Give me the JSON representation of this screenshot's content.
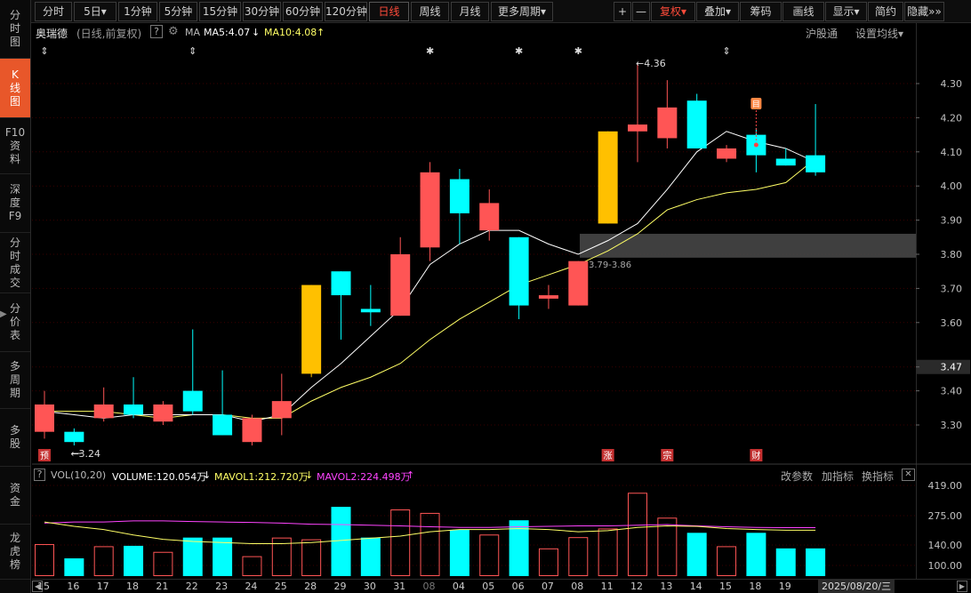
{
  "left_tabs": [
    {
      "label": "分\n时\n图",
      "name": "tab-fenshitu",
      "active": false
    },
    {
      "label": "K\n线\n图",
      "name": "tab-kxiantu",
      "active": true
    },
    {
      "label": "F10\n资\n料",
      "name": "tab-f10",
      "active": false
    },
    {
      "label": "深\n度\nF9",
      "name": "tab-f9",
      "active": false
    },
    {
      "label": "分\n时\n成\n交",
      "name": "tab-fenshichengjiao",
      "active": false
    },
    {
      "label": "分\n价\n表",
      "name": "tab-fenjiabiao",
      "active": false
    },
    {
      "label": "多\n周\n期",
      "name": "tab-duozhouqi",
      "active": false
    },
    {
      "label": "多\n股",
      "name": "tab-duogu",
      "active": false
    },
    {
      "label": "资\n金",
      "name": "tab-zijin",
      "active": false
    },
    {
      "label": "龙\n虎\n榜",
      "name": "tab-longhubang",
      "active": false
    }
  ],
  "toolbar": {
    "periods": [
      "分时",
      "5日▾",
      "1分钟",
      "5分钟",
      "15分钟",
      "30分钟",
      "60分钟",
      "120分钟",
      "日线",
      "周线",
      "月线",
      "更多周期▾"
    ],
    "active_period": "日线",
    "tools": [
      "+",
      "—",
      "复权▾",
      "叠加▾",
      "筹码",
      "画线",
      "显示▾",
      "简约",
      "隐藏»»"
    ]
  },
  "info": {
    "name": "奥瑞德",
    "mode": "(日线,前复权)",
    "help": "?",
    "ma_label": "MA",
    "ma5": "MA5:4.07",
    "ma10": "MA10:4.08",
    "connect": "沪股通",
    "settings": "设置均线▾"
  },
  "colors": {
    "up": "#ff5555",
    "down": "#00ffff",
    "limit_up": "#ffc000",
    "ma5": "#ffffff",
    "ma10": "#ffff66",
    "mavol2": "#ff44ff",
    "grid": "#3a0000"
  },
  "price_axis": {
    "min": 3.22,
    "max": 4.36,
    "ticks": [
      "4.30",
      "4.20",
      "4.10",
      "4.00",
      "3.90",
      "3.80",
      "3.70",
      "3.60",
      "3.47",
      "3.40",
      "3.30"
    ],
    "highlight_tick": "3.47"
  },
  "chart_data": {
    "type": "candlestick",
    "dates": [
      "15",
      "16",
      "17",
      "18",
      "21",
      "22",
      "23",
      "24",
      "25",
      "28",
      "29",
      "30",
      "31",
      "08",
      "04",
      "05",
      "06",
      "07",
      "08",
      "11",
      "12",
      "13",
      "14",
      "15",
      "18",
      "19",
      "20"
    ],
    "candles": [
      {
        "o": 3.28,
        "h": 3.4,
        "l": 3.26,
        "c": 3.36,
        "limit": false
      },
      {
        "o": 3.28,
        "h": 3.29,
        "l": 3.24,
        "c": 3.25,
        "limit": false
      },
      {
        "o": 3.32,
        "h": 3.41,
        "l": 3.31,
        "c": 3.36,
        "limit": false
      },
      {
        "o": 3.36,
        "h": 3.44,
        "l": 3.32,
        "c": 3.33,
        "limit": false
      },
      {
        "o": 3.31,
        "h": 3.37,
        "l": 3.3,
        "c": 3.36,
        "limit": false
      },
      {
        "o": 3.4,
        "h": 3.58,
        "l": 3.33,
        "c": 3.34,
        "limit": false
      },
      {
        "o": 3.33,
        "h": 3.46,
        "l": 3.27,
        "c": 3.27,
        "limit": false
      },
      {
        "o": 3.25,
        "h": 3.33,
        "l": 3.24,
        "c": 3.32,
        "limit": false
      },
      {
        "o": 3.32,
        "h": 3.45,
        "l": 3.27,
        "c": 3.37,
        "limit": false
      },
      {
        "o": 3.45,
        "h": 3.71,
        "l": 3.44,
        "c": 3.71,
        "limit": true
      },
      {
        "o": 3.75,
        "h": 3.75,
        "l": 3.55,
        "c": 3.68,
        "limit": false
      },
      {
        "o": 3.64,
        "h": 3.71,
        "l": 3.59,
        "c": 3.63,
        "limit": false
      },
      {
        "o": 3.62,
        "h": 3.85,
        "l": 3.62,
        "c": 3.8,
        "limit": false
      },
      {
        "o": 3.82,
        "h": 4.07,
        "l": 3.78,
        "c": 4.04,
        "limit": false
      },
      {
        "o": 4.02,
        "h": 4.05,
        "l": 3.83,
        "c": 3.92,
        "limit": false
      },
      {
        "o": 3.87,
        "h": 3.99,
        "l": 3.84,
        "c": 3.95,
        "limit": false
      },
      {
        "o": 3.85,
        "h": 3.85,
        "l": 3.61,
        "c": 3.65,
        "limit": false
      },
      {
        "o": 3.67,
        "h": 3.71,
        "l": 3.64,
        "c": 3.68,
        "limit": false
      },
      {
        "o": 3.65,
        "h": 3.78,
        "l": 3.65,
        "c": 3.78,
        "limit": false
      },
      {
        "o": 3.89,
        "h": 4.16,
        "l": 3.89,
        "c": 4.16,
        "limit": true
      },
      {
        "o": 4.16,
        "h": 4.36,
        "l": 4.07,
        "c": 4.18,
        "limit": false
      },
      {
        "o": 4.14,
        "h": 4.31,
        "l": 4.11,
        "c": 4.23,
        "limit": false
      },
      {
        "o": 4.25,
        "h": 4.27,
        "l": 4.11,
        "c": 4.11,
        "limit": false
      },
      {
        "o": 4.08,
        "h": 4.12,
        "l": 4.07,
        "c": 4.11,
        "limit": false
      },
      {
        "o": 4.15,
        "h": 4.17,
        "l": 4.04,
        "c": 4.09,
        "limit": false
      },
      {
        "o": 4.08,
        "h": 4.11,
        "l": 4.06,
        "c": 4.06,
        "limit": false
      },
      {
        "o": 4.09,
        "h": 4.24,
        "l": 4.03,
        "c": 4.04,
        "limit": false
      }
    ],
    "ma5": [
      3.34,
      3.33,
      3.32,
      3.33,
      3.33,
      3.33,
      3.33,
      3.31,
      3.33,
      3.41,
      3.48,
      3.56,
      3.64,
      3.77,
      3.83,
      3.87,
      3.87,
      3.83,
      3.8,
      3.84,
      3.89,
      3.99,
      4.1,
      4.16,
      4.13,
      4.11,
      4.07
    ],
    "ma10": [
      3.34,
      3.34,
      3.34,
      3.33,
      3.32,
      3.33,
      3.33,
      3.32,
      3.32,
      3.37,
      3.41,
      3.44,
      3.48,
      3.55,
      3.61,
      3.66,
      3.71,
      3.74,
      3.77,
      3.81,
      3.86,
      3.93,
      3.96,
      3.98,
      3.99,
      4.01,
      4.08
    ],
    "annotations": {
      "low": "3.24",
      "high": "4.36",
      "gap": "3.79-3.86",
      "gap_range": [
        3.79,
        3.86
      ]
    },
    "tags": [
      {
        "index": 0,
        "label": "预"
      },
      {
        "index": 19,
        "label": "涨"
      },
      {
        "index": 21,
        "label": "宗"
      },
      {
        "index": 24,
        "label": "财"
      }
    ],
    "note_icon": {
      "index": 24,
      "label": "目"
    },
    "top_markers": [
      {
        "index": 0,
        "glyph": "⇕"
      },
      {
        "index": 5,
        "glyph": "⇕"
      },
      {
        "index": 13,
        "glyph": "✱"
      },
      {
        "index": 16,
        "glyph": "✱"
      },
      {
        "index": 18,
        "glyph": "✱"
      },
      {
        "index": 23,
        "glyph": "⇕"
      }
    ],
    "volume": {
      "max": 419,
      "ticks": [
        "419.00",
        "275.00",
        "140.00",
        "100.00"
      ],
      "values": [
        148,
        82,
        138,
        140,
        112,
        178,
        178,
        92,
        178,
        170,
        320,
        178,
        308,
        292,
        214,
        192,
        258,
        128,
        180,
        220,
        385,
        270,
        200,
        138,
        200,
        128,
        128,
        110
      ],
      "mavol1": [
        250,
        230,
        215,
        190,
        170,
        160,
        155,
        150,
        150,
        155,
        165,
        175,
        185,
        205,
        215,
        215,
        220,
        215,
        205,
        210,
        225,
        232,
        230,
        220,
        215,
        212,
        212
      ],
      "mavol2": [
        245,
        250,
        250,
        255,
        255,
        252,
        250,
        248,
        245,
        240,
        238,
        235,
        232,
        228,
        225,
        225,
        228,
        230,
        232,
        232,
        235,
        238,
        232,
        228,
        225,
        224,
        224
      ]
    }
  },
  "vol_info": {
    "help": "?",
    "label": "VOL(10,20)",
    "volume": "VOLUME:120.054万",
    "mavol1": "MAVOL1:212.720万",
    "mavol2": "MAVOL2:224.498万",
    "buttons": [
      "改参数",
      "加指标",
      "换指标"
    ],
    "close": "✕"
  },
  "date_axis": {
    "current_date": "2025/08/20/三"
  }
}
